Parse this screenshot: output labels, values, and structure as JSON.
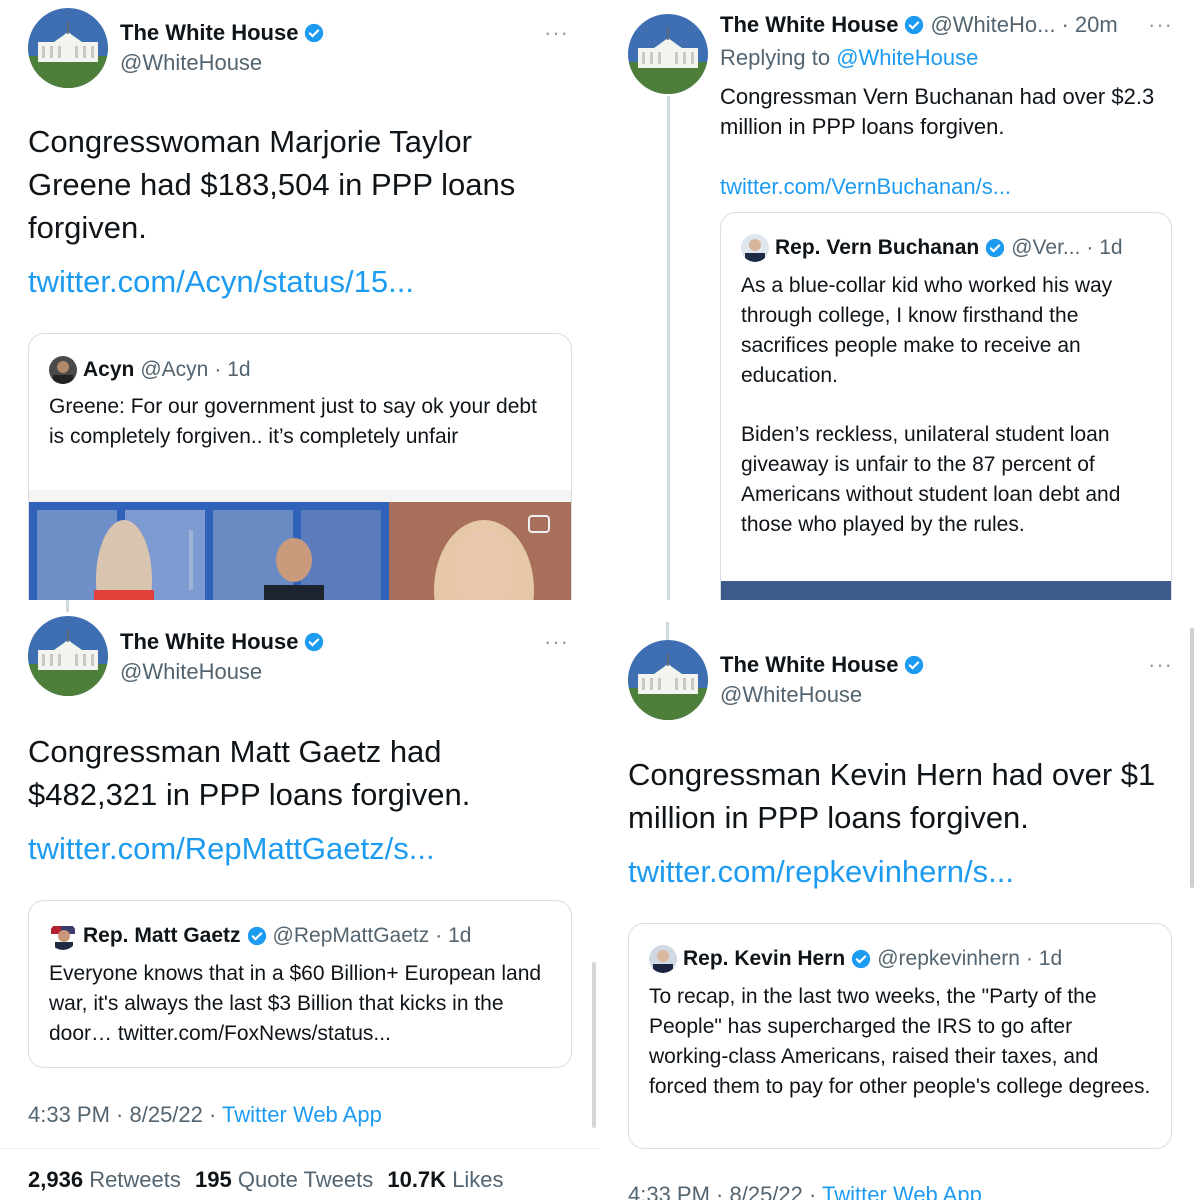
{
  "panel1": {
    "author": {
      "name": "The White House",
      "handle": "@WhiteHouse",
      "icon": "verified-badge-icon"
    },
    "more": "···",
    "text": "Congresswoman Marjorie Taylor Greene had $183,504 in PPP loans forgiven.",
    "link": "twitter.com/Acyn/status/15...",
    "quote": {
      "name": "Acyn",
      "handle": "@Acyn",
      "time": "· 1d",
      "text": "Greene: For our government just to say ok your debt is completely forgiven.. it’s completely unfair"
    }
  },
  "panel2": {
    "author": {
      "name": "The White House",
      "handle": "@WhiteHo...",
      "time": "· 20m"
    },
    "more": "···",
    "replying_prefix": "Replying to",
    "replying_handle": "@WhiteHouse",
    "text": "Congressman Vern Buchanan had over $2.3 million in PPP loans forgiven.",
    "link": "twitter.com/VernBuchanan/s...",
    "quote": {
      "name": "Rep. Vern Buchanan",
      "handle": "@Ver...",
      "time": "· 1d",
      "text1": "As a blue-collar kid who worked his way through college, I know firsthand the sacrifices people make to receive an education.",
      "text2": "Biden’s reckless, unilateral student loan giveaway is unfair to the 87 percent of Americans without student loan debt and those who played by the rules."
    }
  },
  "panel3": {
    "author": {
      "name": "The White House",
      "handle": "@WhiteHouse"
    },
    "more": "···",
    "text": "Congressman Matt Gaetz had $482,321 in PPP loans forgiven.",
    "link": "twitter.com/RepMattGaetz/s...",
    "quote": {
      "name": "Rep. Matt Gaetz",
      "handle": "@RepMattGaetz",
      "time": "· 1d",
      "text": "Everyone knows that in a $60 Billion+ European land war, it's always the last $3 Billion that kicks in the door… twitter.com/FoxNews/status..."
    },
    "timestamp": "4:33 PM · 8/25/22 · ",
    "source": "Twitter Web App",
    "stats": {
      "retweets": "2,936",
      "retweets_label": "Retweets",
      "quotes": "195",
      "quotes_label": "Quote Tweets",
      "likes": "10.7K",
      "likes_label": "Likes"
    }
  },
  "panel4": {
    "author": {
      "name": "The White House",
      "handle": "@WhiteHouse"
    },
    "more": "···",
    "text": "Congressman Kevin Hern had over $1 million in PPP loans forgiven.",
    "link": "twitter.com/repkevinhern/s...",
    "quote": {
      "name": "Rep. Kevin Hern",
      "handle": "@repkevinhern",
      "time": "· 1d",
      "text": "To recap, in the last two weeks, the \"Party of the People\" has supercharged the IRS to go after working-class Americans, raised their taxes, and forced them to pay for other people's college degrees."
    },
    "timestamp": "4:33 PM · 8/25/22 · ",
    "source": "Twitter Web App"
  },
  "colors": {
    "link": "#1d9bf0",
    "text": "#0f1419",
    "muted": "#536471",
    "border": "#d8dee3"
  }
}
